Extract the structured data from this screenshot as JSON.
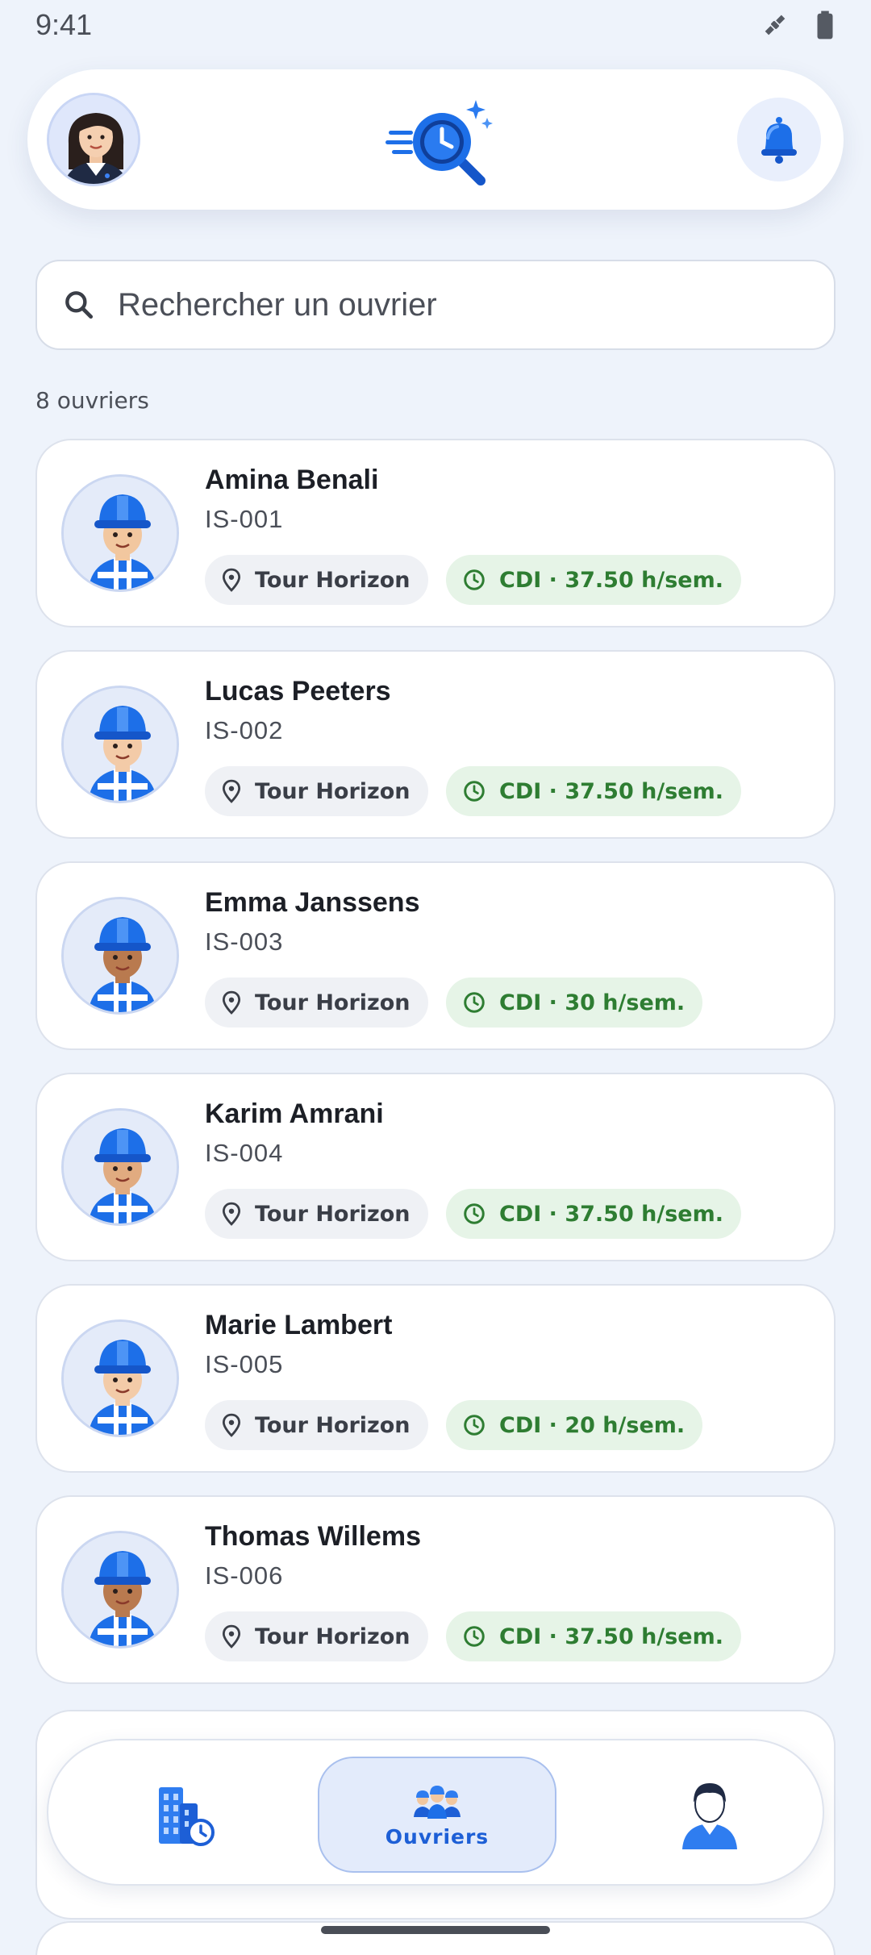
{
  "status_bar": {
    "time": "9:41"
  },
  "header": {
    "user_avatar": "woman-avatar",
    "logo": "clock-search-logo",
    "notification_icon": "bell-icon"
  },
  "search": {
    "placeholder": "Rechercher un ouvrier"
  },
  "count_label": "8 ouvriers",
  "workers": [
    {
      "name": "Amina Benali",
      "id": "IS-001",
      "site": "Tour Horizon",
      "contract": "CDI · 37.50 h/sem.",
      "skin": "#f2c79f"
    },
    {
      "name": "Lucas Peeters",
      "id": "IS-002",
      "site": "Tour Horizon",
      "contract": "CDI · 37.50 h/sem.",
      "skin": "#f3cba8"
    },
    {
      "name": "Emma Janssens",
      "id": "IS-003",
      "site": "Tour Horizon",
      "contract": "CDI · 30 h/sem.",
      "skin": "#b97a4f"
    },
    {
      "name": "Karim Amrani",
      "id": "IS-004",
      "site": "Tour Horizon",
      "contract": "CDI · 37.50 h/sem.",
      "skin": "#e1ab80"
    },
    {
      "name": "Marie Lambert",
      "id": "IS-005",
      "site": "Tour Horizon",
      "contract": "CDI · 20 h/sem.",
      "skin": "#f3cba8"
    },
    {
      "name": "Thomas Willems",
      "id": "IS-006",
      "site": "Tour Horizon",
      "contract": "CDI · 37.50 h/sem.",
      "skin": "#b97a4f"
    }
  ],
  "bottom_nav": {
    "items": [
      {
        "icon": "buildings-clock-icon",
        "label": ""
      },
      {
        "icon": "workers-group-icon",
        "label": "Ouvriers",
        "active": true
      },
      {
        "icon": "user-profile-icon",
        "label": ""
      }
    ]
  },
  "colors": {
    "accent": "#1d5fd6",
    "contract_green": "#2e7d32",
    "background": "#eef3fb"
  }
}
